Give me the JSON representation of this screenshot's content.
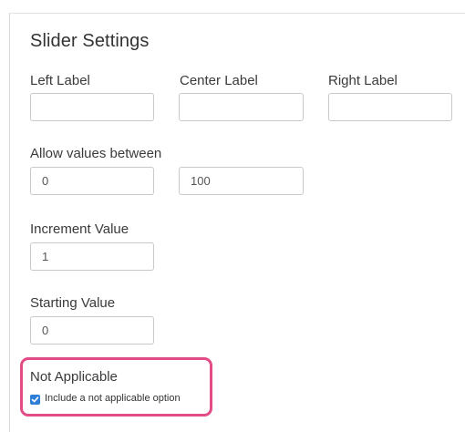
{
  "settings": {
    "title": "Slider Settings",
    "left_label": {
      "label": "Left Label",
      "value": ""
    },
    "center_label": {
      "label": "Center Label",
      "value": ""
    },
    "right_label": {
      "label": "Right Label",
      "value": ""
    },
    "range": {
      "label": "Allow values between",
      "min": "0",
      "max": "100"
    },
    "increment": {
      "label": "Increment Value",
      "value": "1"
    },
    "starting": {
      "label": "Starting Value",
      "value": "0"
    },
    "not_applicable": {
      "heading": "Not Applicable",
      "checkbox_label": "Include a not applicable option",
      "checked": true
    }
  },
  "colors": {
    "highlight_border": "#e14b86",
    "checkbox_fill": "#2f7fd9"
  }
}
